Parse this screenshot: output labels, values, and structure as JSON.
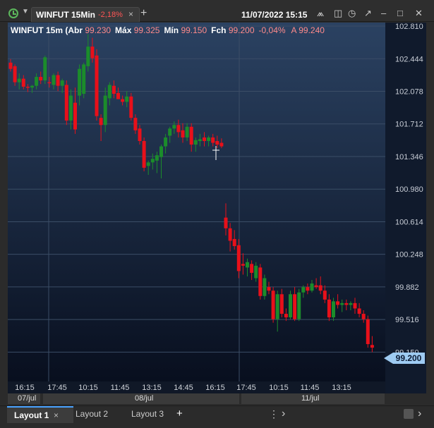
{
  "window": {
    "tab_symbol": "WINFUT 15Min",
    "tab_change": "-2,18%",
    "tab_close": "×",
    "add_tab": "+",
    "datetime": "11/07/2022 15:15"
  },
  "header": {
    "prefix": "WINFUT 15m (",
    "open_label": "Abr ",
    "open_value": "99.230",
    "high_label": "Máx ",
    "high_value": "99.325",
    "low_label": "Mín ",
    "low_value": "99.150",
    "close_label": "Fch ",
    "close_value": "99.200",
    "change": "-0,04%",
    "ask_label": "A ",
    "ask_value": "99.240"
  },
  "colors": {
    "up": "#1b8c2b",
    "down": "#e8101a",
    "label_value": "#ff8080",
    "price_tag": "#9ecbf2"
  },
  "chart_data": {
    "type": "candlestick",
    "y_ticks": [
      "102.810",
      "102.444",
      "102.078",
      "101.712",
      "101.346",
      "100.980",
      "100.614",
      "100.248",
      "99.882",
      "99.516",
      "99.150"
    ],
    "ylim": [
      99.05,
      102.85
    ],
    "x_ticks": [
      "16:15",
      "17:45",
      "10:15",
      "11:45",
      "13:15",
      "14:45",
      "16:15",
      "17:45",
      "10:15",
      "11:45",
      "13:15"
    ],
    "date_labels": [
      "07/jul",
      "08/jul",
      "11/jul"
    ],
    "last_price": "99.200",
    "candles": [
      {
        "o": 102.4,
        "h": 102.44,
        "l": 102.3,
        "c": 102.33
      },
      {
        "o": 102.36,
        "h": 102.38,
        "l": 102.14,
        "c": 102.18
      },
      {
        "o": 102.18,
        "h": 102.28,
        "l": 102.1,
        "c": 102.22
      },
      {
        "o": 102.22,
        "h": 102.26,
        "l": 102.1,
        "c": 102.13
      },
      {
        "o": 102.13,
        "h": 102.16,
        "l": 102.07,
        "c": 102.12
      },
      {
        "o": 102.12,
        "h": 102.15,
        "l": 102.06,
        "c": 102.14
      },
      {
        "o": 102.14,
        "h": 102.28,
        "l": 102.1,
        "c": 102.24
      },
      {
        "o": 102.24,
        "h": 102.3,
        "l": 102.16,
        "c": 102.2
      },
      {
        "o": 102.2,
        "h": 102.48,
        "l": 102.16,
        "c": 102.46
      },
      {
        "o": 102.18,
        "h": 102.24,
        "l": 102.12,
        "c": 102.17
      },
      {
        "o": 102.15,
        "h": 102.28,
        "l": 102.1,
        "c": 102.26
      },
      {
        "o": 102.26,
        "h": 102.3,
        "l": 102.08,
        "c": 102.14
      },
      {
        "o": 102.14,
        "h": 102.22,
        "l": 102.06,
        "c": 102.2
      },
      {
        "o": 102.15,
        "h": 102.2,
        "l": 101.7,
        "c": 101.75
      },
      {
        "o": 101.75,
        "h": 102.1,
        "l": 101.65,
        "c": 102.03
      },
      {
        "o": 101.95,
        "h": 102.12,
        "l": 101.6,
        "c": 101.65
      },
      {
        "o": 102.03,
        "h": 102.38,
        "l": 101.92,
        "c": 102.33
      },
      {
        "o": 102.05,
        "h": 102.4,
        "l": 102.0,
        "c": 102.38
      },
      {
        "o": 102.36,
        "h": 102.72,
        "l": 102.3,
        "c": 102.58
      },
      {
        "o": 102.58,
        "h": 102.68,
        "l": 102.4,
        "c": 102.45
      },
      {
        "o": 102.48,
        "h": 102.55,
        "l": 101.75,
        "c": 101.8
      },
      {
        "o": 101.78,
        "h": 101.82,
        "l": 101.52,
        "c": 101.7
      },
      {
        "o": 101.7,
        "h": 102.12,
        "l": 101.62,
        "c": 102.03
      },
      {
        "o": 102.0,
        "h": 102.18,
        "l": 101.92,
        "c": 102.15
      },
      {
        "o": 102.14,
        "h": 102.2,
        "l": 102.0,
        "c": 102.05
      },
      {
        "o": 102.06,
        "h": 102.12,
        "l": 102.0,
        "c": 101.99
      },
      {
        "o": 101.99,
        "h": 102.03,
        "l": 101.92,
        "c": 101.96
      },
      {
        "o": 101.96,
        "h": 102.08,
        "l": 101.9,
        "c": 102.02
      },
      {
        "o": 102.02,
        "h": 102.06,
        "l": 101.75,
        "c": 101.78
      },
      {
        "o": 101.78,
        "h": 101.82,
        "l": 101.6,
        "c": 101.64
      },
      {
        "o": 101.66,
        "h": 101.7,
        "l": 101.48,
        "c": 101.52
      },
      {
        "o": 101.52,
        "h": 101.56,
        "l": 101.18,
        "c": 101.22
      },
      {
        "o": 101.24,
        "h": 101.3,
        "l": 101.14,
        "c": 101.28
      },
      {
        "o": 101.28,
        "h": 101.38,
        "l": 101.2,
        "c": 101.32
      },
      {
        "o": 101.3,
        "h": 101.4,
        "l": 101.16,
        "c": 101.36
      },
      {
        "o": 101.34,
        "h": 101.48,
        "l": 101.1,
        "c": 101.46
      },
      {
        "o": 101.46,
        "h": 101.6,
        "l": 101.38,
        "c": 101.56
      },
      {
        "o": 101.58,
        "h": 101.68,
        "l": 101.5,
        "c": 101.66
      },
      {
        "o": 101.66,
        "h": 101.74,
        "l": 101.6,
        "c": 101.7
      },
      {
        "o": 101.7,
        "h": 101.76,
        "l": 101.56,
        "c": 101.62
      },
      {
        "o": 101.64,
        "h": 101.72,
        "l": 101.5,
        "c": 101.56
      },
      {
        "o": 101.56,
        "h": 101.72,
        "l": 101.52,
        "c": 101.68
      },
      {
        "o": 101.68,
        "h": 101.72,
        "l": 101.4,
        "c": 101.48
      },
      {
        "o": 101.48,
        "h": 101.56,
        "l": 101.4,
        "c": 101.53
      },
      {
        "o": 101.52,
        "h": 101.6,
        "l": 101.46,
        "c": 101.54
      },
      {
        "o": 101.56,
        "h": 101.62,
        "l": 101.46,
        "c": 101.52
      },
      {
        "o": 101.52,
        "h": 101.58,
        "l": 101.46,
        "c": 101.56
      },
      {
        "o": 101.56,
        "h": 101.6,
        "l": 101.46,
        "c": 101.5
      },
      {
        "o": 101.52,
        "h": 101.58,
        "l": 101.44,
        "c": 101.48
      },
      {
        "o": 101.5,
        "h": 101.55,
        "l": 101.44,
        "c": 101.46
      },
      {
        "o": 100.66,
        "h": 100.82,
        "l": 100.46,
        "c": 100.54
      },
      {
        "o": 100.54,
        "h": 100.6,
        "l": 100.28,
        "c": 100.4
      },
      {
        "o": 100.42,
        "h": 100.52,
        "l": 100.3,
        "c": 100.34
      },
      {
        "o": 100.35,
        "h": 100.42,
        "l": 99.98,
        "c": 100.06
      },
      {
        "o": 100.14,
        "h": 100.26,
        "l": 100.02,
        "c": 100.12
      },
      {
        "o": 100.1,
        "h": 100.2,
        "l": 100.0,
        "c": 100.16
      },
      {
        "o": 100.14,
        "h": 100.18,
        "l": 99.96,
        "c": 100.04
      },
      {
        "o": 99.98,
        "h": 100.16,
        "l": 99.94,
        "c": 100.12
      },
      {
        "o": 100.1,
        "h": 100.14,
        "l": 99.74,
        "c": 99.78
      },
      {
        "o": 99.78,
        "h": 100.02,
        "l": 99.74,
        "c": 99.98
      },
      {
        "o": 99.88,
        "h": 99.94,
        "l": 99.8,
        "c": 99.84
      },
      {
        "o": 99.84,
        "h": 99.88,
        "l": 99.48,
        "c": 99.52
      },
      {
        "o": 99.52,
        "h": 99.84,
        "l": 99.38,
        "c": 99.8
      },
      {
        "o": 99.8,
        "h": 99.86,
        "l": 99.54,
        "c": 99.58
      },
      {
        "o": 99.58,
        "h": 99.64,
        "l": 99.5,
        "c": 99.54
      },
      {
        "o": 99.54,
        "h": 99.84,
        "l": 99.52,
        "c": 99.8
      },
      {
        "o": 99.8,
        "h": 99.88,
        "l": 99.5,
        "c": 99.52
      },
      {
        "o": 99.52,
        "h": 99.86,
        "l": 99.5,
        "c": 99.82
      },
      {
        "o": 99.82,
        "h": 99.9,
        "l": 99.76,
        "c": 99.88
      },
      {
        "o": 99.88,
        "h": 99.92,
        "l": 99.8,
        "c": 99.84
      },
      {
        "o": 99.84,
        "h": 99.96,
        "l": 99.82,
        "c": 99.92
      },
      {
        "o": 99.9,
        "h": 99.98,
        "l": 99.86,
        "c": 99.88
      },
      {
        "o": 99.9,
        "h": 100.0,
        "l": 99.8,
        "c": 99.84
      },
      {
        "o": 99.84,
        "h": 99.9,
        "l": 99.7,
        "c": 99.74
      },
      {
        "o": 99.74,
        "h": 99.8,
        "l": 99.5,
        "c": 99.54
      },
      {
        "o": 99.54,
        "h": 99.76,
        "l": 99.5,
        "c": 99.72
      },
      {
        "o": 99.72,
        "h": 99.8,
        "l": 99.64,
        "c": 99.68
      },
      {
        "o": 99.68,
        "h": 99.74,
        "l": 99.6,
        "c": 99.7
      },
      {
        "o": 99.7,
        "h": 99.74,
        "l": 99.62,
        "c": 99.68
      },
      {
        "o": 99.68,
        "h": 99.72,
        "l": 99.62,
        "c": 99.7
      },
      {
        "o": 99.7,
        "h": 99.76,
        "l": 99.58,
        "c": 99.64
      },
      {
        "o": 99.64,
        "h": 99.7,
        "l": 99.54,
        "c": 99.58
      },
      {
        "o": 99.58,
        "h": 99.62,
        "l": 99.48,
        "c": 99.52
      },
      {
        "o": 99.52,
        "h": 99.56,
        "l": 99.2,
        "c": 99.24
      },
      {
        "o": 99.23,
        "h": 99.33,
        "l": 99.15,
        "c": 99.2
      }
    ]
  },
  "layouts": {
    "tab1": "Layout 1",
    "tab1_close": "×",
    "tab2": "Layout 2",
    "tab3": "Layout 3",
    "add": "+",
    "menu": "⋮",
    "nav_left": "‹",
    "nav_right": "›"
  }
}
